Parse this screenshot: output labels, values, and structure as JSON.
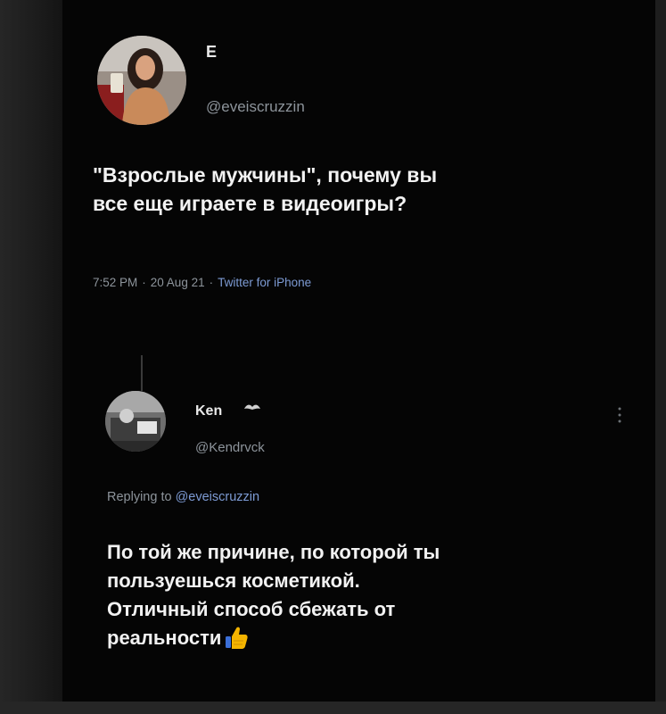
{
  "tweet": {
    "display_name": "E",
    "handle": "@eveiscruzzin",
    "text": "\"Взрослые мужчины\", почему вы\nвсе еще играете в видеоигры?",
    "time": "7:52 PM",
    "date": "20 Aug 21",
    "separator": "·",
    "source": "Twitter for iPhone"
  },
  "reply": {
    "display_name": "Ken",
    "name_emoji": "moustache-emoji",
    "handle": "@Kendrvck",
    "replying_prefix": "Replying to",
    "replying_to": "@eveiscruzzin",
    "text": "По той же причине, по которой ты\nпользуешься косметикой.\nОтличный способ сбежать от\nреальности",
    "trailing_emoji": "thumbs-up-emoji"
  },
  "colors": {
    "background": "#050505",
    "text": "#f2f2f2",
    "secondary": "#8d949b",
    "link": "#7d9bd4",
    "thumbs_up": "#f4b400"
  }
}
